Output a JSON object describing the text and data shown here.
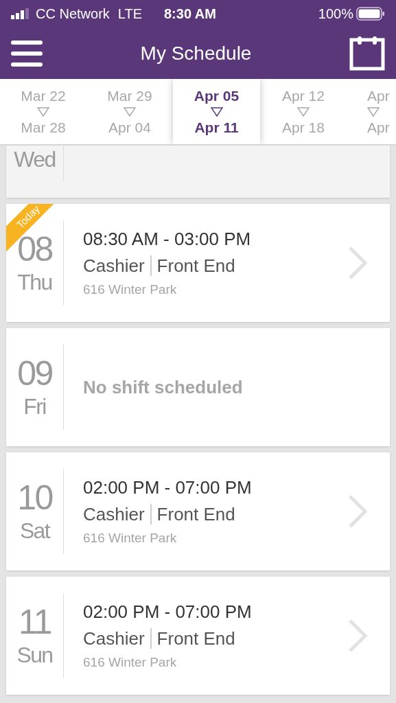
{
  "status_bar": {
    "carrier": "CC Network",
    "network": "LTE",
    "time": "8:30 AM",
    "battery": "100%"
  },
  "header": {
    "title": "My Schedule"
  },
  "weeks": [
    {
      "start": "Mar 22",
      "end": "Mar 28",
      "selected": false
    },
    {
      "start": "Mar 29",
      "end": "Apr 04",
      "selected": false
    },
    {
      "start": "Apr 05",
      "end": "Apr 11",
      "selected": true
    },
    {
      "start": "Apr 12",
      "end": "Apr 18",
      "selected": false
    },
    {
      "start": "Apr",
      "end": "Apr",
      "selected": false
    }
  ],
  "days": [
    {
      "kind": "past",
      "weekday": "Wed"
    },
    {
      "kind": "shift",
      "day": "08",
      "weekday": "Thu",
      "badge": "Today",
      "time": "08:30 AM - 03:00 PM",
      "role": "Cashier",
      "department": "Front End",
      "location": "616 Winter Park"
    },
    {
      "kind": "off",
      "day": "09",
      "weekday": "Fri",
      "message": "No shift scheduled"
    },
    {
      "kind": "shift",
      "day": "10",
      "weekday": "Sat",
      "time": "02:00 PM - 07:00 PM",
      "role": "Cashier",
      "department": "Front End",
      "location": "616 Winter Park"
    },
    {
      "kind": "shift",
      "day": "11",
      "weekday": "Sun",
      "time": "02:00 PM - 07:00 PM",
      "role": "Cashier",
      "department": "Front End",
      "location": "616 Winter Park"
    }
  ]
}
